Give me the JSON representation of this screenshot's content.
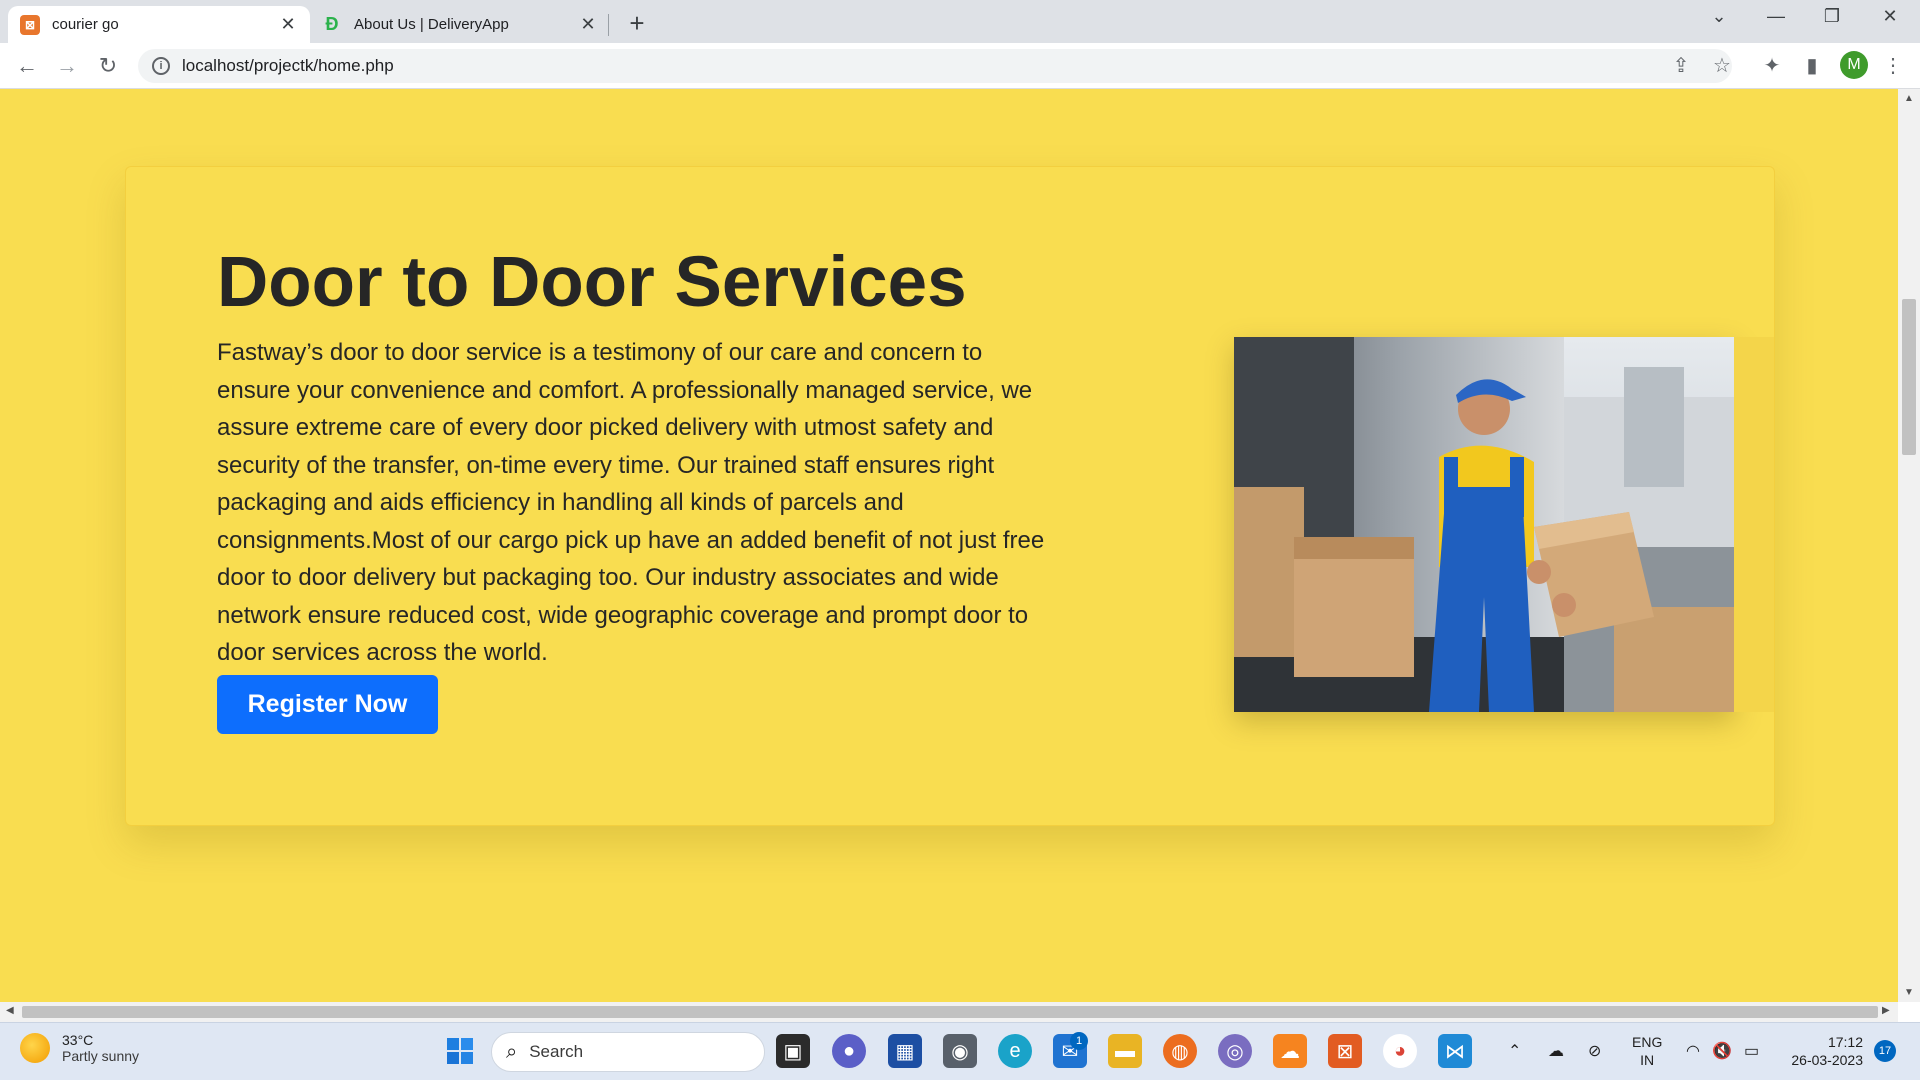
{
  "browser": {
    "tabs": [
      {
        "title": "courier go",
        "active": true
      },
      {
        "title": "About Us | DeliveryApp",
        "active": false
      }
    ],
    "url": "localhost/projectk/home.php",
    "profile_initial": "M"
  },
  "page": {
    "headline": "Door to Door Services",
    "body": "Fastway’s door to door service is a testimony of our care and concern to ensure your convenience and comfort. A professionally managed service, we assure extreme care of every door picked delivery with utmost safety and security of the transfer, on-time every time. Our trained staff ensures right packaging and aids efficiency in handling all kinds of parcels and consignments.Most of our cargo pick up have an added benefit of not just free door to door delivery but packaging too. Our industry associates and wide network ensure reduced cost, wide geographic coverage and prompt door to door services across the world.",
    "cta_label": "Register Now",
    "colors": {
      "page_bg": "#f9dd50",
      "button": "#0d6efd",
      "text": "#262626"
    }
  },
  "taskbar": {
    "weather_temp": "33°C",
    "weather_desc": "Partly sunny",
    "search_placeholder": "Search",
    "mail_badge": "1",
    "lang_top": "ENG",
    "lang_bottom": "IN",
    "time": "17:12",
    "date": "26-03-2023",
    "notification_count": "17"
  }
}
